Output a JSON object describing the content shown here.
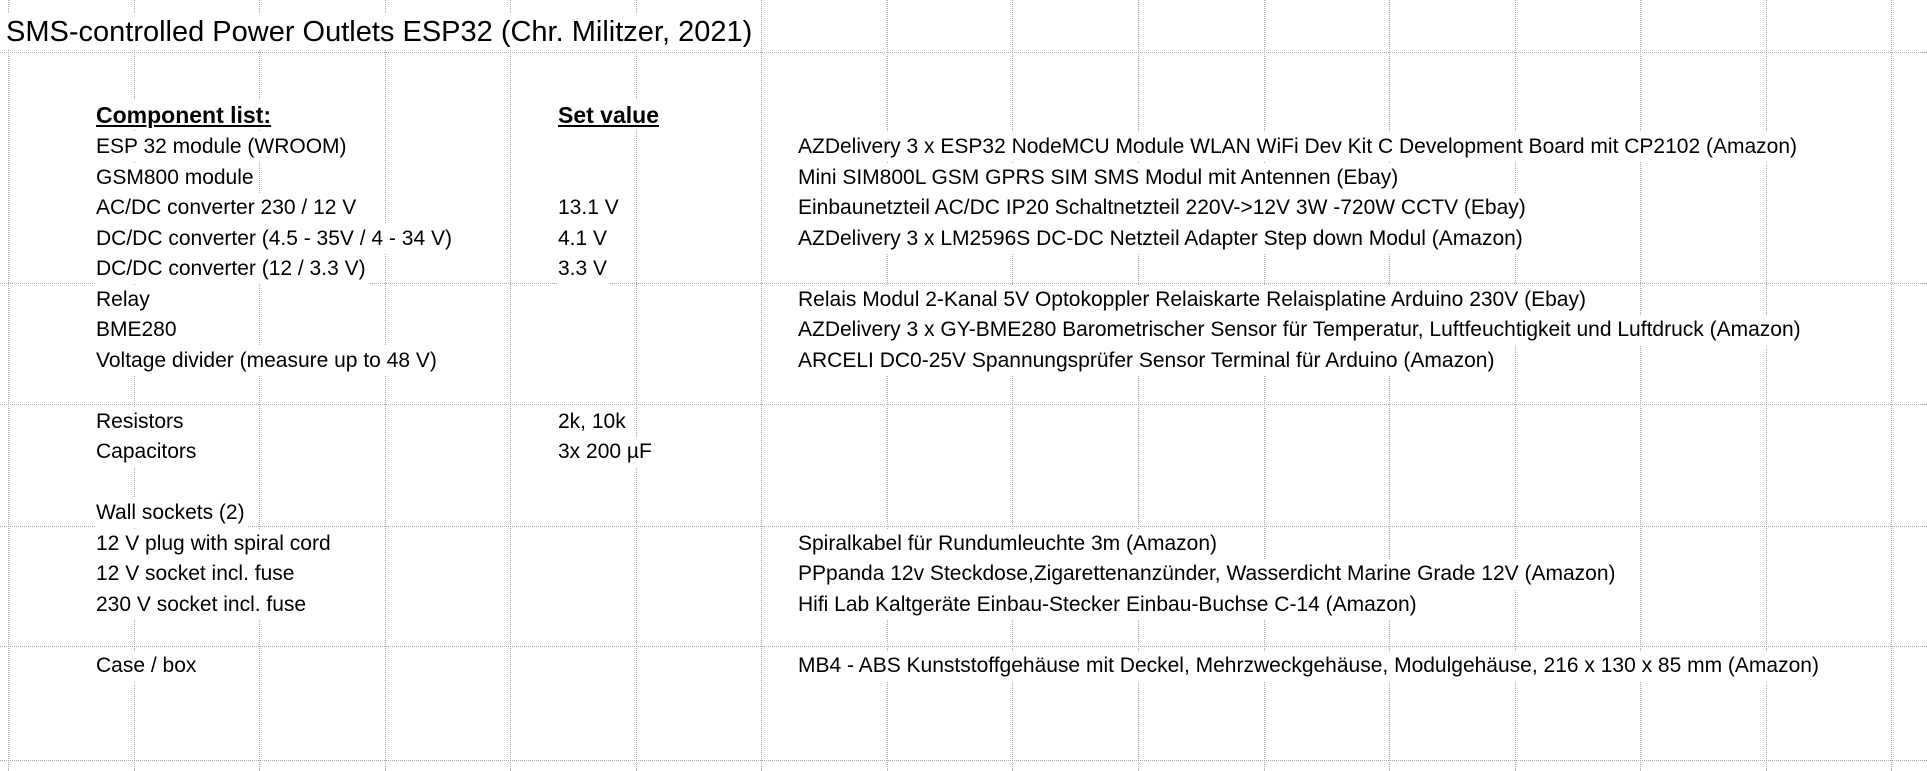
{
  "title": "SMS-controlled Power Outlets ESP32 (Chr. Militzer, 2021)",
  "headers": {
    "component": "Component list:",
    "set_value": "Set value"
  },
  "rows": [
    {
      "component": "ESP 32 module (WROOM)",
      "value": "",
      "source": "AZDelivery 3 x ESP32 NodeMCU Module WLAN WiFi Dev Kit C Development Board mit CP2102 (Amazon)"
    },
    {
      "component": "GSM800 module",
      "value": "",
      "source": "Mini SIM800L GSM GPRS SIM SMS Modul mit Antennen (Ebay)"
    },
    {
      "component": "AC/DC converter 230 / 12 V",
      "value": "13.1 V",
      "source": "Einbaunetzteil AC/DC IP20 Schaltnetzteil 220V->12V 3W -720W CCTV (Ebay)"
    },
    {
      "component": "DC/DC converter (4.5 - 35V / 4 - 34 V)",
      "value": "4.1 V",
      "source": "AZDelivery 3 x LM2596S DC-DC Netzteil Adapter Step down Modul (Amazon)"
    },
    {
      "component": "DC/DC converter (12 / 3.3 V)",
      "value": "3.3 V",
      "source": ""
    },
    {
      "component": "Relay",
      "value": "",
      "source": "Relais Modul 2-Kanal 5V Optokoppler Relaiskarte Relaisplatine Arduino 230V (Ebay)"
    },
    {
      "component": "BME280",
      "value": "",
      "source": "AZDelivery 3 x GY-BME280 Barometrischer Sensor für Temperatur, Luftfeuchtigkeit und Luftdruck (Amazon)"
    },
    {
      "component": "Voltage divider (measure up to 48 V)",
      "value": "",
      "source": "ARCELI DC0-25V Spannungsprüfer Sensor Terminal für Arduino (Amazon)"
    },
    {
      "component": "",
      "value": "",
      "source": ""
    },
    {
      "component": "Resistors",
      "value": "2k, 10k",
      "source": ""
    },
    {
      "component": "Capacitors",
      "value": "3x 200 µF",
      "source": ""
    },
    {
      "component": "",
      "value": "",
      "source": ""
    },
    {
      "component": "Wall sockets (2)",
      "value": "",
      "source": ""
    },
    {
      "component": "12 V plug with spiral cord",
      "value": "",
      "source": "Spiralkabel für Rundumleuchte 3m (Amazon)"
    },
    {
      "component": "12 V socket incl. fuse",
      "value": "",
      "source": "PPpanda 12v Steckdose,Zigarettenanzünder, Wasserdicht Marine Grade 12V (Amazon)"
    },
    {
      "component": "230 V socket incl. fuse",
      "value": "",
      "source": "Hifi Lab Kaltgeräte Einbau-Stecker Einbau-Buchse C-14 (Amazon)"
    },
    {
      "component": "",
      "value": "",
      "source": ""
    },
    {
      "component": "Case / box",
      "value": "",
      "source": "MB4 - ABS Kunststoffgehäuse mit Deckel, Mehrzweckgehäuse, Modulgehäuse, 216 x 130 x 85 mm (Amazon)"
    }
  ]
}
